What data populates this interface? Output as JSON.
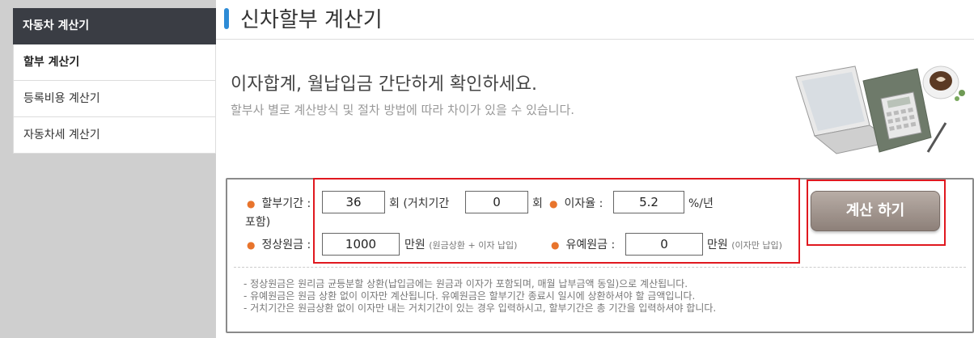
{
  "sidebar": {
    "header": "자동차 계산기",
    "items": [
      "할부 계산기",
      "등록비용 계산기",
      "자동차세 계산기"
    ]
  },
  "main": {
    "title": "신차할부 계산기",
    "hero_title": "이자합계, 월납입금 간단하게 확인하세요.",
    "hero_sub": "할부사 별로 계산방식 및 절차 방법에 따라 차이가 있을 수 있습니다."
  },
  "form": {
    "period_label": "할부기간 :",
    "period_value": "36",
    "period_unit": "회 (거치기간",
    "grace_value": "0",
    "grace_unit": "회",
    "included_label": "포함)",
    "rate_label": "이자율 :",
    "rate_value": "5.2",
    "rate_unit": "%/년",
    "principal_label": "정상원금 :",
    "principal_value": "1000",
    "principal_unit": "만원",
    "principal_note": "(원금상환 + 이자 납입)",
    "deferred_label": "유예원금 :",
    "deferred_value": "0",
    "deferred_unit": "만원",
    "deferred_note": "(이자만 납입)",
    "calc_button": "계산 하기"
  },
  "notes": [
    "- 정상원금은 원리금 균등분할 상환(납입금에는 원금과 이자가 포함되며, 매월 납부금액 동일)으로 계산됩니다.",
    "- 유예원금은 원금 상환 없이 이자만 계산됩니다. 유예원금은 할부기간 종료시 일시에 상환하셔야 할 금액입니다.",
    "- 거치기간은 원금상환 없이 이자만 내는 거치기간이 있는 경우 입력하시고, 할부기간은 총 기간을 입력하셔야 합니다."
  ]
}
